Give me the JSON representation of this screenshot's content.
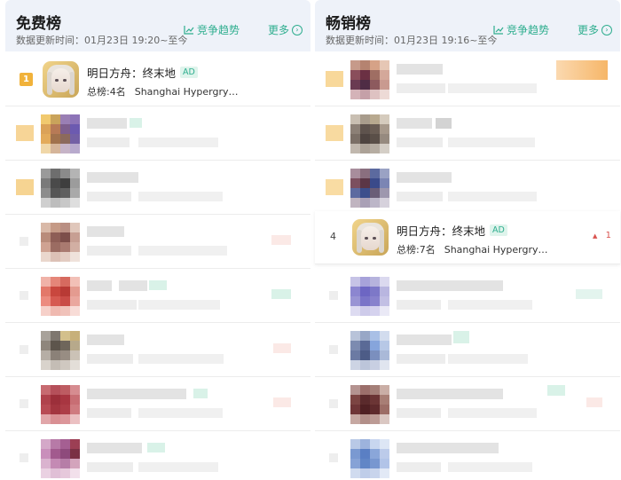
{
  "free": {
    "title": "免费榜",
    "update": "数据更新时间：01月23日 19:20~至今",
    "trend_label": "竞争趋势",
    "more_label": "更多",
    "featured": {
      "rank": "1",
      "name": "明日方舟：终末地",
      "ad": "AD",
      "total": "总榜:4名",
      "developer": "Shanghai Hypergry…"
    }
  },
  "sales": {
    "title": "畅销榜",
    "update": "数据更新时间：01月23日 19:16~至今",
    "trend_label": "竞争趋势",
    "more_label": "更多",
    "featured": {
      "rank": "4",
      "name": "明日方舟：终末地",
      "ad": "AD",
      "total": "总榜:7名",
      "developer": "Shanghai Hypergry…",
      "change": "1",
      "change_arrow": "▲"
    }
  },
  "icons": {
    "trend": "line-chart-icon",
    "more": "chevron-right-circle-icon"
  },
  "colors": {
    "accent": "#2fae8f",
    "header_bg": "#eef2f9",
    "rank1_badge": "#f1b23a",
    "rank_up": "#d9534f"
  }
}
